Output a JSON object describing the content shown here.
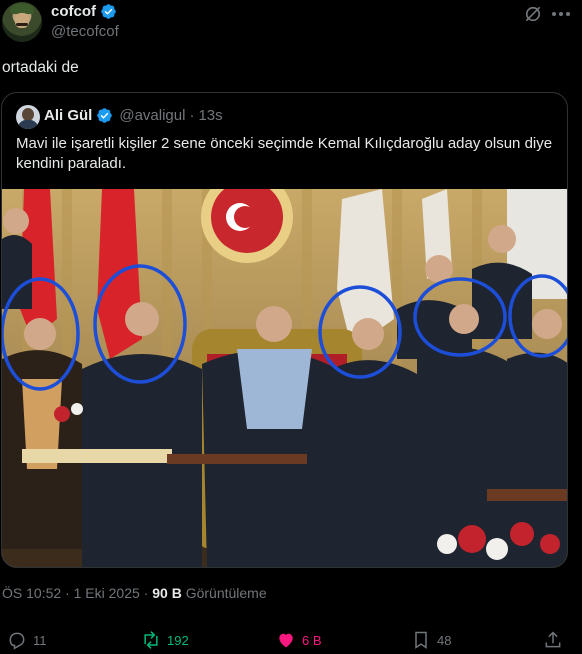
{
  "author": {
    "display_name": "cofcof",
    "handle": "@tecofcof",
    "verified": true
  },
  "post": {
    "text": "ortadaki de"
  },
  "quoted": {
    "display_name": "Ali Gül",
    "handle": "@avaligul",
    "separator": "·",
    "time": "13s",
    "text": "Mavi ile işaretli kişiler 2 sene önceki seçimde Kemal Kılıçdaroğlu aday olsun diye kendini paraladı."
  },
  "meta": {
    "time": "ÖS 10:52",
    "separator1": "·",
    "date": "1 Eki 2025",
    "separator2": "·",
    "views_count": "90 B",
    "views_label": "Görüntüleme"
  },
  "actions": {
    "reply_count": "11",
    "repost_count": "192",
    "like_count": "6 B",
    "bookmark_count": "48"
  },
  "colors": {
    "background": "#000000",
    "text": "#e7e9ea",
    "muted": "#71767b",
    "verified": "#1d9bf0",
    "repost": "#00ba7c",
    "like": "#f91880"
  }
}
